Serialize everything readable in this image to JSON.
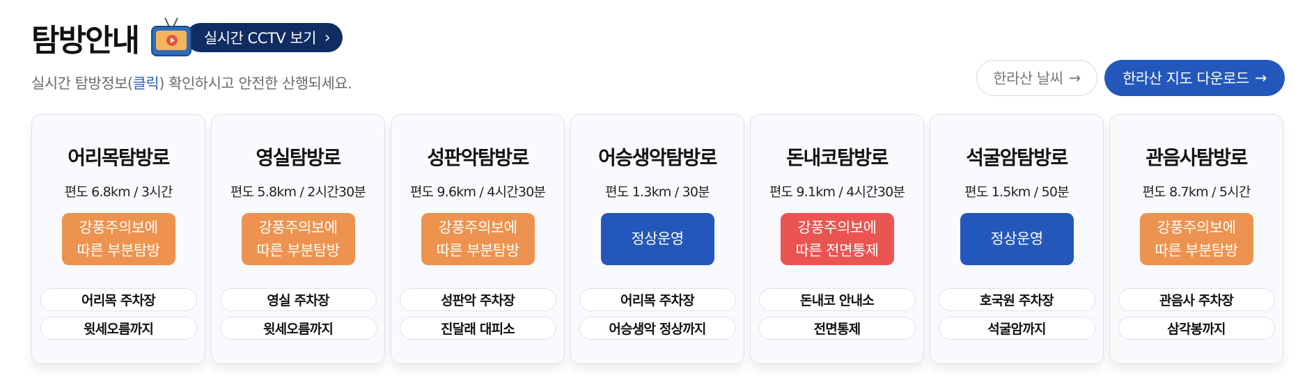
{
  "header": {
    "title": "탐방안내",
    "cctv_label": "실시간 CCTV 보기",
    "subtitle_prefix": "실시간 탐방정보(",
    "subtitle_link": "클릭",
    "subtitle_suffix": ") 확인하시고 안전한 산행되세요.",
    "weather_button": "한라산 날씨",
    "map_button": "한라산 지도 다운로드"
  },
  "colors": {
    "partial": "#ee934f",
    "normal": "#2457bb",
    "closed": "#ea5552"
  },
  "trails": [
    {
      "name": "어리목탐방로",
      "info": "편도 6.8km / 3시간",
      "status_line1": "강풍주의보에",
      "status_line2": "따른 부분탐방",
      "status_type": "partial",
      "start": "어리목 주차장",
      "end": "윗세오름까지"
    },
    {
      "name": "영실탐방로",
      "info": "편도 5.8km / 2시간30분",
      "status_line1": "강풍주의보에",
      "status_line2": "따른 부분탐방",
      "status_type": "partial",
      "start": "영실 주차장",
      "end": "윗세오름까지"
    },
    {
      "name": "성판악탐방로",
      "info": "편도 9.6km / 4시간30분",
      "status_line1": "강풍주의보에",
      "status_line2": "따른 부분탐방",
      "status_type": "partial",
      "start": "성판악 주차장",
      "end": "진달래 대피소"
    },
    {
      "name": "어승생악탐방로",
      "info": "편도 1.3km / 30분",
      "status_line1": "정상운영",
      "status_line2": "",
      "status_type": "normal",
      "start": "어리목 주차장",
      "end": "어승생악 정상까지"
    },
    {
      "name": "돈내코탐방로",
      "info": "편도 9.1km / 4시간30분",
      "status_line1": "강풍주의보에",
      "status_line2": "따른 전면통제",
      "status_type": "closed",
      "start": "돈내코 안내소",
      "end": "전면통제"
    },
    {
      "name": "석굴암탐방로",
      "info": "편도 1.5km / 50분",
      "status_line1": "정상운영",
      "status_line2": "",
      "status_type": "normal",
      "start": "호국원 주차장",
      "end": "석굴암까지"
    },
    {
      "name": "관음사탐방로",
      "info": "편도 8.7km / 5시간",
      "status_line1": "강풍주의보에",
      "status_line2": "따른 부분탐방",
      "status_type": "partial",
      "start": "관음사 주차장",
      "end": "삼각봉까지"
    }
  ]
}
